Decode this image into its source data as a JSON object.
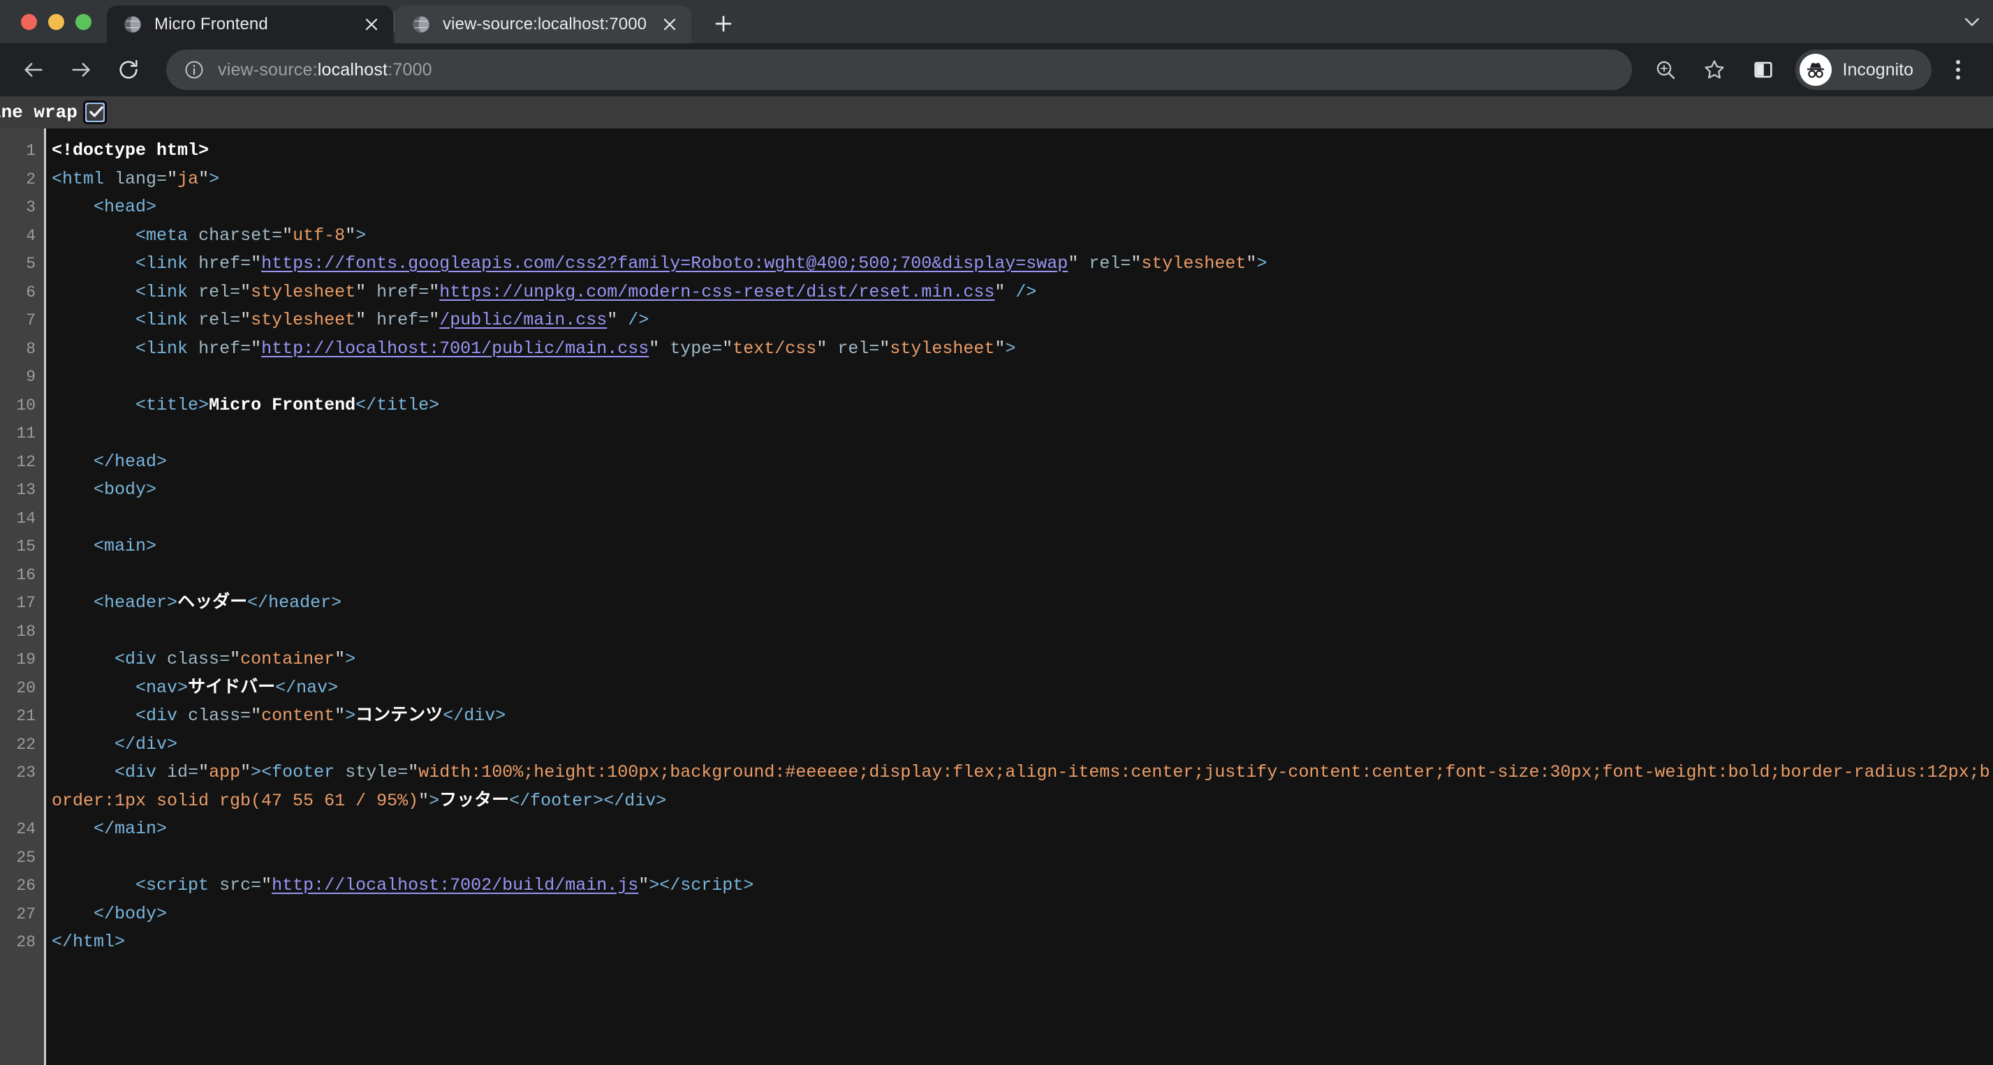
{
  "browser": {
    "traffic_lights": [
      "close",
      "minimize",
      "zoom"
    ],
    "tabs": [
      {
        "title": "Micro Frontend",
        "favicon": "globe-icon",
        "active": false
      },
      {
        "title": "view-source:localhost:7000",
        "favicon": "globe-icon",
        "active": true
      }
    ],
    "new_tab_label": "+",
    "tabstrip_chevron": "chevron-down-icon",
    "toolbar": {
      "back_label": "←",
      "forward_label": "→",
      "reload_label": "↻",
      "url_prefix": "view-source:",
      "url_host": "localhost",
      "url_suffix": ":7000",
      "url_full": "view-source:localhost:7000",
      "zoom_icon": "zoom-in-icon",
      "bookmark_icon": "star-icon",
      "sidepanel_icon": "side-panel-icon",
      "profile_label": "Incognito",
      "profile_icon": "incognito-icon",
      "menu_icon": "kebab-menu-icon"
    }
  },
  "view_source": {
    "line_wrap_label": "ine wrap",
    "line_wrap_checked": true,
    "line_numbers": [
      1,
      2,
      3,
      4,
      5,
      6,
      7,
      8,
      9,
      10,
      11,
      12,
      13,
      14,
      15,
      16,
      17,
      18,
      19,
      20,
      21,
      22,
      23,
      24,
      25,
      26,
      27,
      28
    ],
    "source_lines": [
      "<!doctype html>",
      "<html lang=\"ja\">",
      "    <head>",
      "        <meta charset=\"utf-8\">",
      "        <link href=\"https://fonts.googleapis.com/css2?family=Roboto:wght@400;500;700&display=swap\" rel=\"stylesheet\">",
      "        <link rel=\"stylesheet\" href=\"https://unpkg.com/modern-css-reset/dist/reset.min.css\" />",
      "        <link rel=\"stylesheet\" href=\"/public/main.css\" />",
      "        <link href=\"http://localhost:7001/public/main.css\" type=\"text/css\" rel=\"stylesheet\">",
      "",
      "        <title>Micro Frontend</title>",
      "",
      "    </head>",
      "    <body>",
      "",
      "    <main>",
      "",
      "    <header>ヘッダー</header>",
      "",
      "      <div class=\"container\">",
      "        <nav>サイドバー</nav>",
      "        <div class=\"content\">コンテンツ</div>",
      "      </div>",
      "      <div id=\"app\"><footer style=\"width:100%;height:100px;background:#eeeeee;display:flex;align-items:center;justify-content:center;font-size:30px;font-weight:bold;border-radius:12px;border:1px solid rgb(47 55 61 / 95%)\">フッター</footer></div>",
      "    </main>",
      "",
      "        <script src=\"http://localhost:7002/build/main.js\"></script>",
      "    </body>",
      "</html>"
    ],
    "colors": {
      "background": "#131313",
      "gutter_background": "#414141",
      "gutter_text": "#9d9d9d",
      "tag": "#7ab6dd",
      "attribute": "#9fb8c4",
      "value": "#eb9d68",
      "link": "#9a95f5",
      "text_node": "#ffffff",
      "line_wrap_bar": "#3b3b3b",
      "checkbox_accent": "#9ec2f7"
    }
  }
}
